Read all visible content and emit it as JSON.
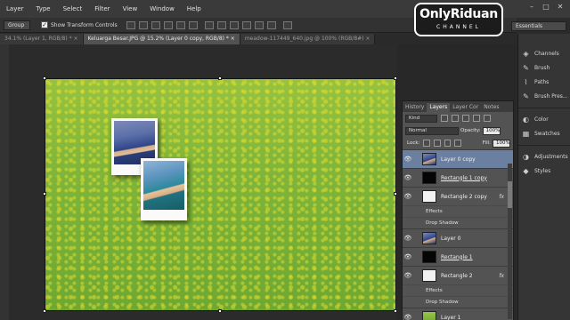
{
  "menu": [
    "Layer",
    "Type",
    "Select",
    "Filter",
    "View",
    "Window",
    "Help"
  ],
  "logo": {
    "name": "OnlyRiduan",
    "subtitle": "CHANNEL"
  },
  "options": {
    "auto_select": "Group",
    "transform_label": "Show Transform Controls",
    "transform_checked": "✓",
    "workspace": "Essentials"
  },
  "tabs": [
    {
      "label": "34.1% (Layer 1, RGB/8) *  ×"
    },
    {
      "label": "Keluarga Besar.JPG @ 15.2% (Layer 0 copy, RGB/8) *  ×"
    },
    {
      "label": "meadow-117449_640.jpg @ 100% (RGB/8#)  ×"
    }
  ],
  "dock": {
    "group1": [
      {
        "icon": "channels-icon",
        "glyph": "◈",
        "label": "Channels"
      },
      {
        "icon": "brush-icon",
        "glyph": "✎",
        "label": "Brush"
      },
      {
        "icon": "paths-icon",
        "glyph": "⌇",
        "label": "Paths"
      },
      {
        "icon": "brush-presets-icon",
        "glyph": "✎",
        "label": "Brush Pres..."
      }
    ],
    "group2": [
      {
        "icon": "color-icon",
        "glyph": "◐",
        "label": "Color"
      },
      {
        "icon": "swatches-icon",
        "glyph": "▦",
        "label": "Swatches"
      }
    ],
    "group3": [
      {
        "icon": "adjustments-icon",
        "glyph": "◑",
        "label": "Adjustments"
      },
      {
        "icon": "styles-icon",
        "glyph": "◆",
        "label": "Styles"
      }
    ]
  },
  "layers_panel": {
    "tabs": [
      "History",
      "Layers",
      "Layer Cor",
      "Notes"
    ],
    "filter": "Kind",
    "blend_mode": "Normal",
    "opacity_label": "Opacity:",
    "opacity": "100%",
    "lock_label": "Lock:",
    "fill_label": "Fill:",
    "fill": "100%",
    "layers": [
      {
        "name": "Layer 0 copy",
        "selected": true,
        "thumb": "photo"
      },
      {
        "name": "Rectangle 1 copy",
        "thumb": "black"
      },
      {
        "name": "Rectangle 2 copy",
        "thumb": "white",
        "fx": "fx",
        "effects": [
          "Effects",
          "Drop Shadow"
        ]
      },
      {
        "name": "Layer 0",
        "thumb": "photo"
      },
      {
        "name": "Rectangle 1",
        "thumb": "black"
      },
      {
        "name": "Rectangle 2",
        "thumb": "white",
        "fx": "fx",
        "effects": [
          "Effects",
          "Drop Shadow"
        ]
      },
      {
        "name": "Layer 1",
        "thumb": "grass"
      }
    ]
  },
  "colors": {
    "selection": "#6b7fa0",
    "panel": "#535353",
    "canvas_bg": "#282828"
  }
}
